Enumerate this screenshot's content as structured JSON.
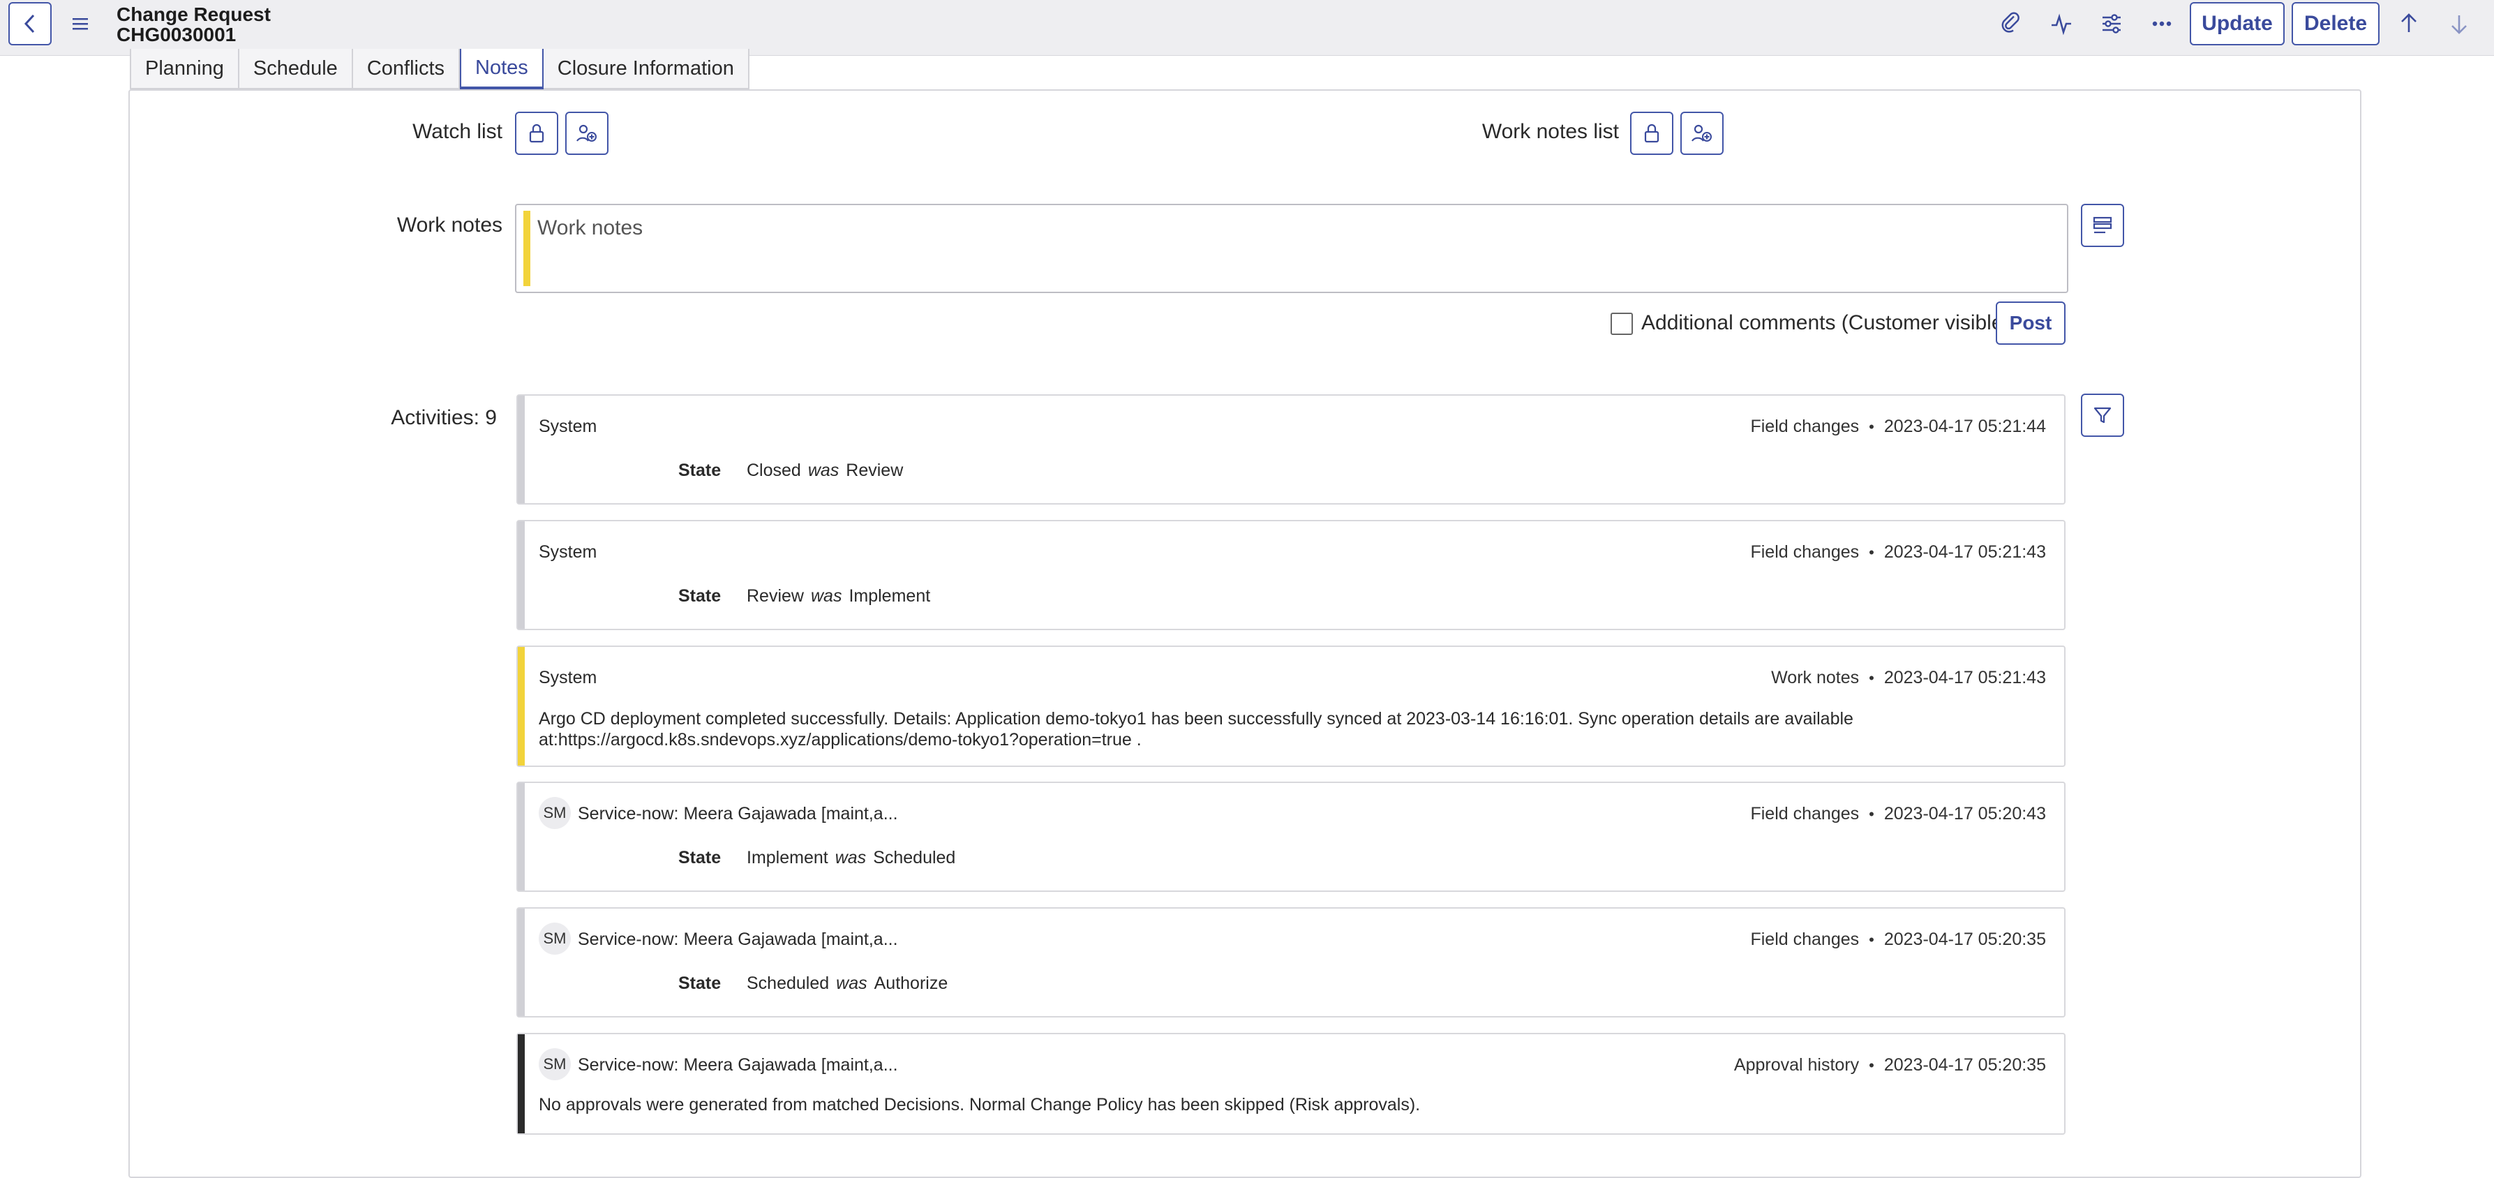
{
  "header": {
    "title": "Change Request",
    "number": "CHG0030001",
    "update_label": "Update",
    "delete_label": "Delete"
  },
  "tabs": [
    {
      "label": "Planning"
    },
    {
      "label": "Schedule"
    },
    {
      "label": "Conflicts"
    },
    {
      "label": "Notes",
      "active": true
    },
    {
      "label": "Closure Information"
    }
  ],
  "form": {
    "watch_list_label": "Watch list",
    "work_notes_list_label": "Work notes list",
    "work_notes_label": "Work notes",
    "work_notes_placeholder": "Work notes",
    "additional_comments_label": "Additional comments (Customer visible)",
    "post_label": "Post",
    "activities_label": "Activities: 9"
  },
  "activities": [
    {
      "author": "System",
      "type": "Field changes",
      "time": "2023-04-17 05:21:44",
      "field": "State",
      "new": "Closed",
      "was": "was",
      "old": "Review"
    },
    {
      "author": "System",
      "type": "Field changes",
      "time": "2023-04-17 05:21:43",
      "field": "State",
      "new": "Review",
      "was": "was",
      "old": "Implement"
    },
    {
      "author": "System",
      "type": "Work notes",
      "time": "2023-04-17 05:21:43",
      "body_line1": "Argo CD deployment completed successfully. Details: Application demo-tokyo1 has been successfully synced at 2023-03-14 16:16:01. Sync operation details are available",
      "body_line2": "at:https://argocd.k8s.sndevops.xyz/applications/demo-tokyo1?operation=true ."
    },
    {
      "avatar": "SM",
      "author": "Service-now: Meera Gajawada [maint,a...",
      "type": "Field changes",
      "time": "2023-04-17 05:20:43",
      "field": "State",
      "new": "Implement",
      "was": "was",
      "old": "Scheduled"
    },
    {
      "avatar": "SM",
      "author": "Service-now: Meera Gajawada [maint,a...",
      "type": "Field changes",
      "time": "2023-04-17 05:20:35",
      "field": "State",
      "new": "Scheduled",
      "was": "was",
      "old": "Authorize"
    },
    {
      "avatar": "SM",
      "author": "Service-now: Meera Gajawada [maint,a...",
      "type": "Approval history",
      "time": "2023-04-17 05:20:35",
      "body_line1": "No approvals were generated from matched Decisions. Normal Change Policy has been skipped (Risk approvals)."
    }
  ],
  "colors": {
    "accent": "#4356a8",
    "work_note_bar": "#f2d33b",
    "field_change_bar": "#d0d0d5",
    "approval_bar": "#2b2b2b"
  },
  "icons": [
    "back-icon",
    "hamburger-menu-icon",
    "paperclip-icon",
    "activity-pulse-icon",
    "sliders-icon",
    "more-icon",
    "arrow-up-icon",
    "arrow-down-icon",
    "lock-icon",
    "add-user-icon",
    "stack-icon",
    "filter-icon"
  ]
}
